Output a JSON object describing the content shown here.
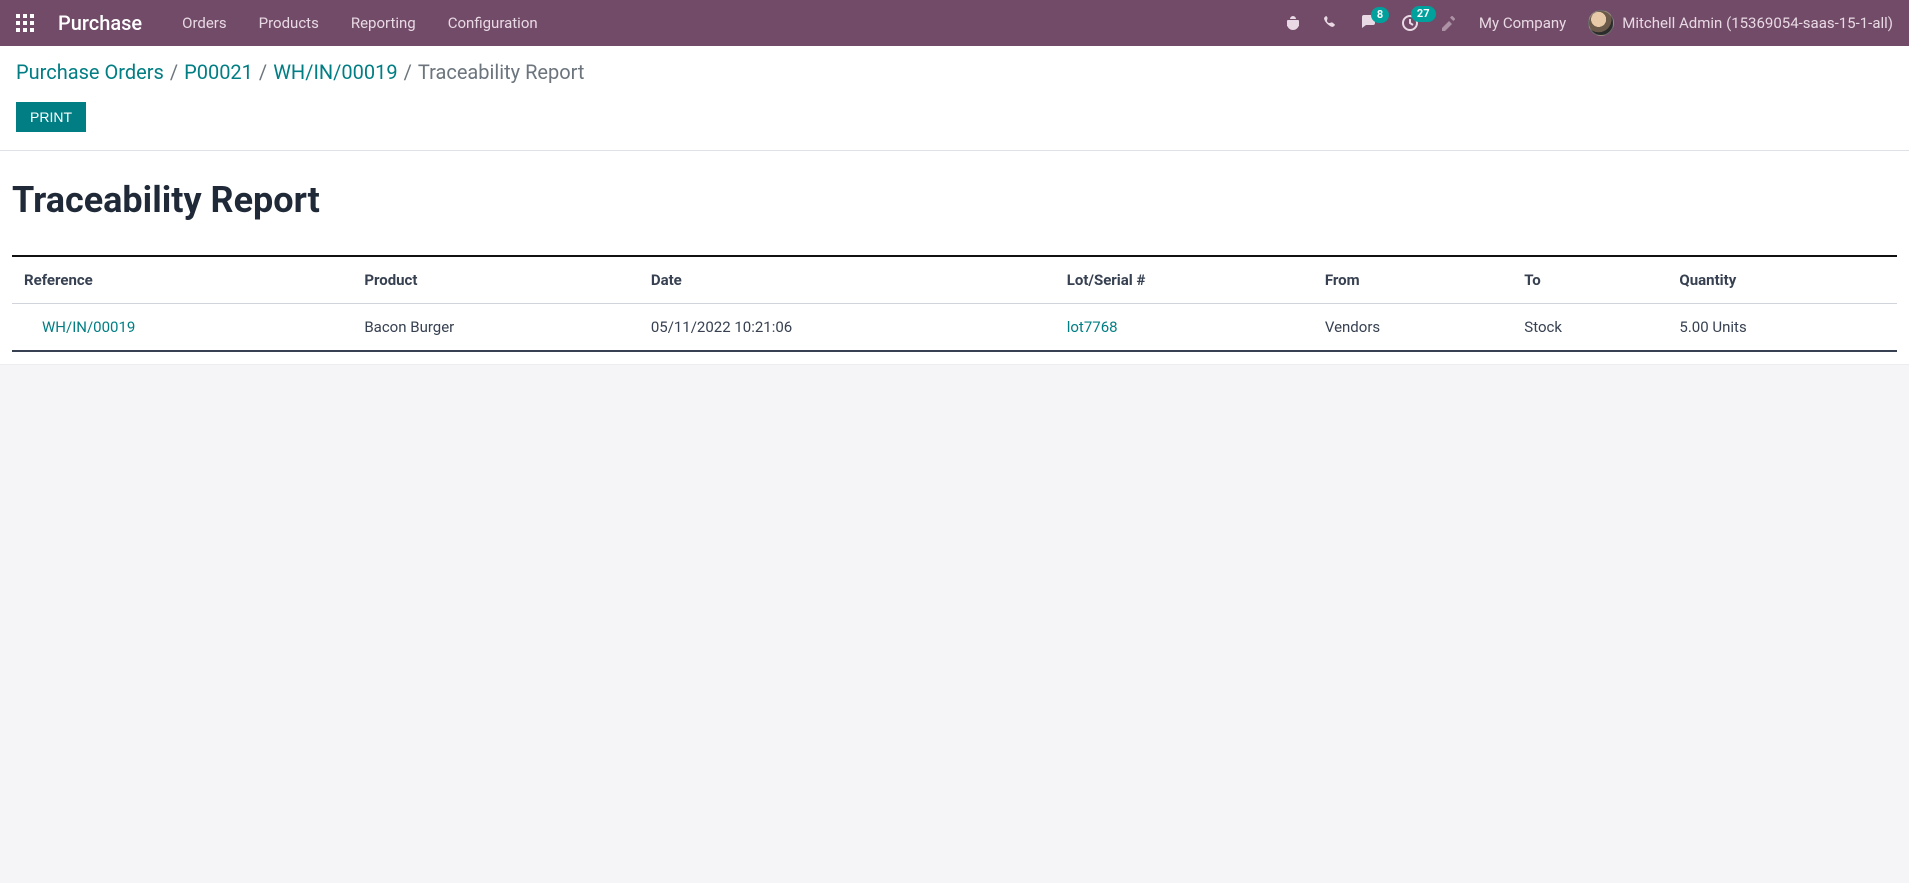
{
  "navbar": {
    "app_title": "Purchase",
    "menu": [
      "Orders",
      "Products",
      "Reporting",
      "Configuration"
    ],
    "messages_badge": "8",
    "activities_badge": "27",
    "company": "My Company",
    "user": "Mitchell Admin (15369054-saas-15-1-all)"
  },
  "breadcrumb": {
    "items": [
      "Purchase Orders",
      "P00021",
      "WH/IN/00019"
    ],
    "current": "Traceability Report"
  },
  "buttons": {
    "print": "PRINT"
  },
  "report": {
    "title": "Traceability Report",
    "columns": {
      "reference": "Reference",
      "product": "Product",
      "date": "Date",
      "lot": "Lot/Serial #",
      "from": "From",
      "to": "To",
      "quantity": "Quantity"
    },
    "rows": [
      {
        "reference": "WH/IN/00019",
        "product": "Bacon Burger",
        "date": "05/11/2022 10:21:06",
        "lot": "lot7768",
        "from": "Vendors",
        "to": "Stock",
        "quantity": "5.00 Units"
      }
    ]
  }
}
